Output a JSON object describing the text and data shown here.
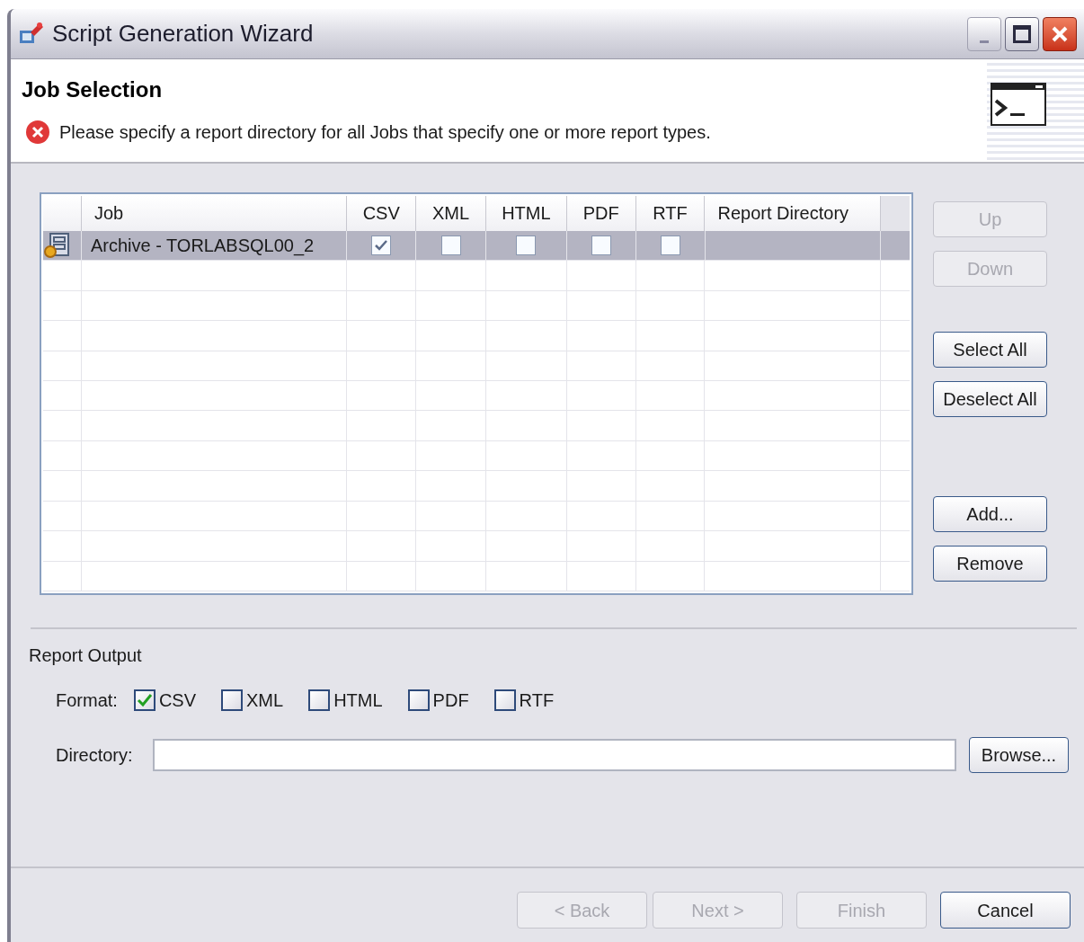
{
  "window": {
    "title": "Script Generation Wizard"
  },
  "header": {
    "title": "Job Selection",
    "error": "Please specify a report directory for all Jobs that specify one or more report types."
  },
  "table": {
    "columns": [
      "Job",
      "CSV",
      "XML",
      "HTML",
      "PDF",
      "RTF",
      "Report Directory"
    ],
    "rows": [
      {
        "job": "Archive - TORLABSQL00_2",
        "selected": true,
        "csv": true,
        "xml": false,
        "html": false,
        "pdf": false,
        "rtf": false,
        "report_directory": ""
      }
    ]
  },
  "side_buttons": [
    {
      "label": "Up",
      "disabled": true
    },
    {
      "label": "Down",
      "disabled": true
    },
    {
      "label": "Select All",
      "disabled": false
    },
    {
      "label": "Deselect All",
      "disabled": false
    },
    {
      "label": "Add...",
      "disabled": false
    },
    {
      "label": "Remove",
      "disabled": false
    }
  ],
  "report_output": {
    "title": "Report Output",
    "format_label": "Format:",
    "formats": [
      {
        "label": "CSV",
        "checked": true
      },
      {
        "label": "XML",
        "checked": false
      },
      {
        "label": "HTML",
        "checked": false
      },
      {
        "label": "PDF",
        "checked": false
      },
      {
        "label": "RTF",
        "checked": false
      }
    ],
    "directory_label": "Directory:",
    "browse": "Browse..."
  },
  "footer_buttons": [
    {
      "label": "< Back",
      "disabled": true
    },
    {
      "label": "Next >",
      "disabled": true
    },
    {
      "label": "Finish",
      "disabled": true
    },
    {
      "label": "Cancel",
      "disabled": false
    }
  ]
}
